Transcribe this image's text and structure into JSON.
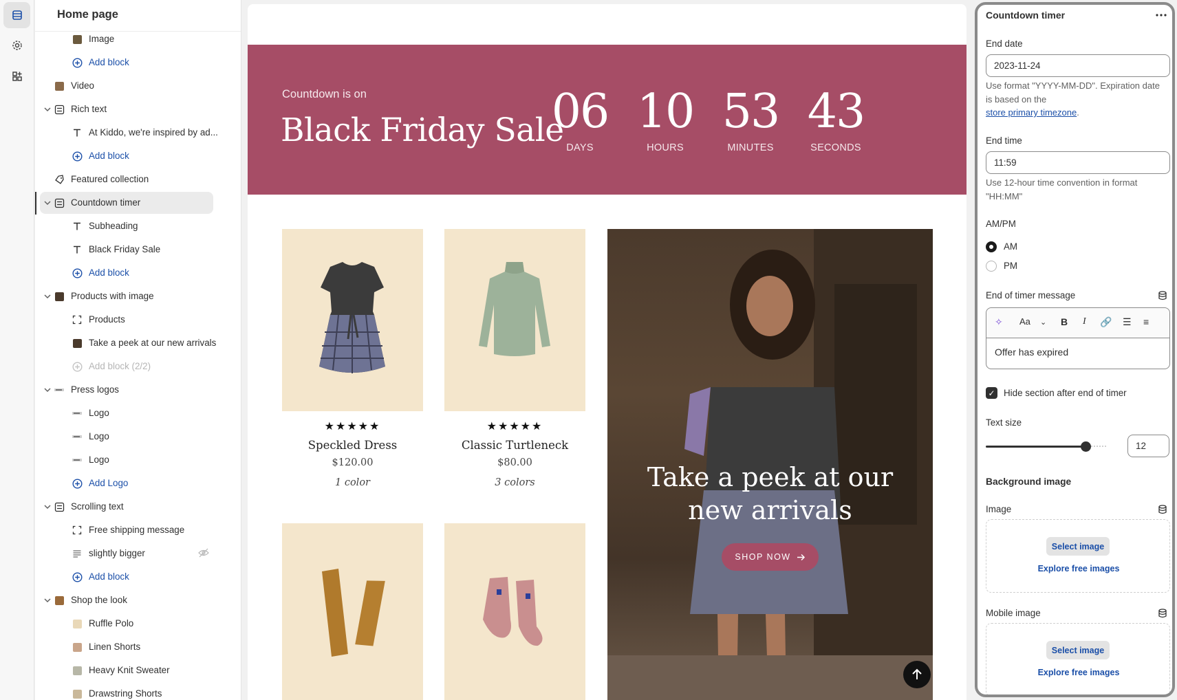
{
  "tree": {
    "title": "Home page",
    "rows": [
      {
        "label": "Image",
        "kind": "thumb",
        "color": "#6b5a3e"
      },
      {
        "label": "Add block",
        "kind": "add"
      },
      {
        "label": "Video",
        "kind": "thumb",
        "color": "#8a6a4a"
      },
      {
        "label": "Rich text",
        "kind": "section"
      },
      {
        "label": "At Kiddo, we're inspired by ad...",
        "kind": "text"
      },
      {
        "label": "Add block",
        "kind": "add"
      },
      {
        "label": "Featured collection",
        "kind": "tag"
      },
      {
        "label": "Countdown timer",
        "kind": "section"
      },
      {
        "label": "Subheading",
        "kind": "text"
      },
      {
        "label": "Black Friday Sale",
        "kind": "text"
      },
      {
        "label": "Add block",
        "kind": "add"
      },
      {
        "label": "Products with image",
        "kind": "thumb",
        "color": "#4a3a2c"
      },
      {
        "label": "Products",
        "kind": "frame"
      },
      {
        "label": "Take a peek at our new arrivals",
        "kind": "thumb",
        "color": "#4a3a2c"
      },
      {
        "label": "Add block (2/2)",
        "kind": "add-disabled"
      },
      {
        "label": "Press logos",
        "kind": "logo"
      },
      {
        "label": "Logo",
        "kind": "logo"
      },
      {
        "label": "Logo",
        "kind": "logo"
      },
      {
        "label": "Logo",
        "kind": "logo"
      },
      {
        "label": "Add Logo",
        "kind": "add"
      },
      {
        "label": "Scrolling text",
        "kind": "section"
      },
      {
        "label": "Free shipping message",
        "kind": "frame"
      },
      {
        "label": "slightly bigger",
        "kind": "lines"
      },
      {
        "label": "Add block",
        "kind": "add"
      },
      {
        "label": "Shop the look",
        "kind": "thumb",
        "color": "#9a6a3a"
      },
      {
        "label": "Ruffle Polo",
        "kind": "thumb",
        "color": "#e9d8b8"
      },
      {
        "label": "Linen Shorts",
        "kind": "thumb",
        "color": "#c9a58a"
      },
      {
        "label": "Heavy Knit Sweater",
        "kind": "thumb",
        "color": "#b7b7a7"
      },
      {
        "label": "Drawstring Shorts",
        "kind": "thumb",
        "color": "#c9b89a"
      }
    ]
  },
  "banner": {
    "subheading": "Countdown is on",
    "title": "Black Friday Sale",
    "units": [
      {
        "value": "06",
        "label": "DAYS"
      },
      {
        "value": "10",
        "label": "HOURS"
      },
      {
        "value": "53",
        "label": "MINUTES"
      },
      {
        "value": "43",
        "label": "SECONDS"
      }
    ]
  },
  "products": [
    {
      "name": "Speckled Dress",
      "price": "$120.00",
      "colors": "1 color",
      "stars": "★★★★★"
    },
    {
      "name": "Classic Turtleneck",
      "price": "$80.00",
      "colors": "3 colors",
      "stars": "★★★★★"
    }
  ],
  "hero": {
    "title_line1": "Take a peek at our",
    "title_line2": "new arrivals",
    "button": "SHOP NOW"
  },
  "panel": {
    "title": "Countdown timer",
    "more_icon": "more-horizontal-icon",
    "end_date_label": "End date",
    "end_date_value": "2023-11-24",
    "end_date_help": "Use format \"YYYY-MM-DD\". Expiration date is based on the",
    "end_date_link": "store primary timezone",
    "end_time_label": "End time",
    "end_time_value": "11:59",
    "end_time_help": "Use 12-hour time convention in format \"HH:MM\"",
    "ampm_label": "AM/PM",
    "am": "AM",
    "pm": "PM",
    "message_label": "End of timer message",
    "message_value": "Offer has expired",
    "toolbar_font": "Aa",
    "hide_label": "Hide section after end of timer",
    "text_size_label": "Text size",
    "text_size_value": "12",
    "bg_heading": "Background image",
    "image_label": "Image",
    "mobile_image_label": "Mobile image",
    "select_image": "Select image",
    "explore_images": "Explore free images"
  }
}
